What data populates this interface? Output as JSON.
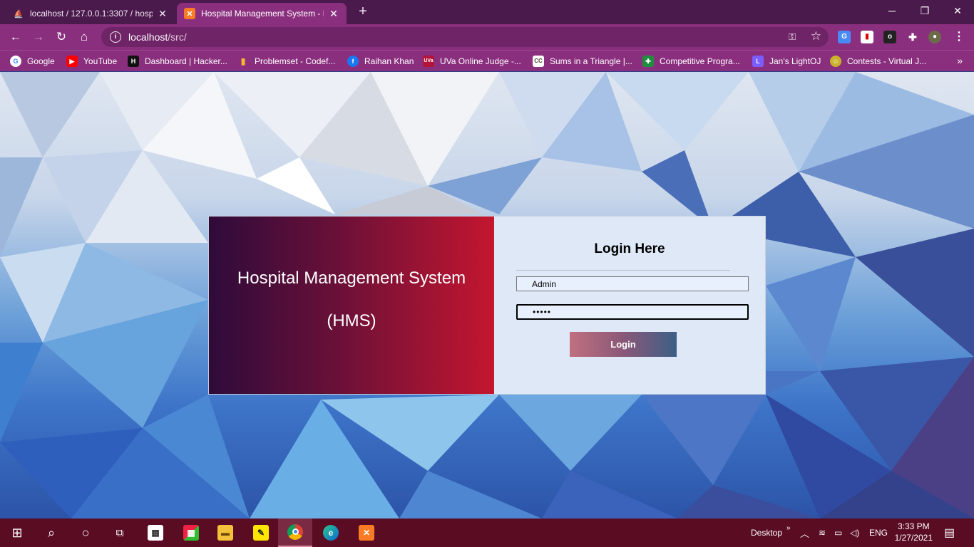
{
  "browser": {
    "tabs": [
      {
        "title": "localhost / 127.0.0.1:3307 / hospi",
        "icon": "phpmyadmin-icon",
        "active": false
      },
      {
        "title": "Hospital Management System - L",
        "icon": "xampp-icon",
        "active": true
      }
    ],
    "url_host": "localhost",
    "url_path": "/src/",
    "bookmarks": [
      {
        "label": "Google",
        "icon": "google-icon",
        "color": "#ffffff"
      },
      {
        "label": "YouTube",
        "icon": "youtube-icon",
        "color": "#ff0000"
      },
      {
        "label": "Dashboard | Hacker...",
        "icon": "hackerrank-icon",
        "color": "#111111"
      },
      {
        "label": "Problemset - Codef...",
        "icon": "codeforces-icon",
        "color": "#1f8acb"
      },
      {
        "label": "Raihan Khan",
        "icon": "facebook-icon",
        "color": "#1877f2"
      },
      {
        "label": "UVa Online Judge -...",
        "icon": "uva-icon",
        "color": "#b5133a"
      },
      {
        "label": "Sums in a Triangle |...",
        "icon": "codechef-icon",
        "color": "#5b4638"
      },
      {
        "label": "Competitive Progra...",
        "icon": "plus-icon",
        "color": "#1e8e3e"
      },
      {
        "label": "Jan's LightOJ",
        "icon": "lightoj-icon",
        "color": "#7b5cff"
      },
      {
        "label": "Contests - Virtual J...",
        "icon": "vjudge-icon",
        "color": "#c9b22a"
      }
    ]
  },
  "login": {
    "system_title": "Hospital Management System",
    "system_abbr": "(HMS)",
    "heading": "Login Here",
    "username_value": "Admin",
    "password_value": "•••••",
    "button_label": "Login"
  },
  "taskbar": {
    "desktop_label": "Desktop",
    "language": "ENG",
    "time": "3:33 PM",
    "date": "1/27/2021"
  },
  "colors": {
    "tabstrip": "#4a1a4c",
    "toolbar": "#8a2f7e",
    "taskbar": "#5a0c22",
    "login_panel": "#dfe8f7"
  }
}
